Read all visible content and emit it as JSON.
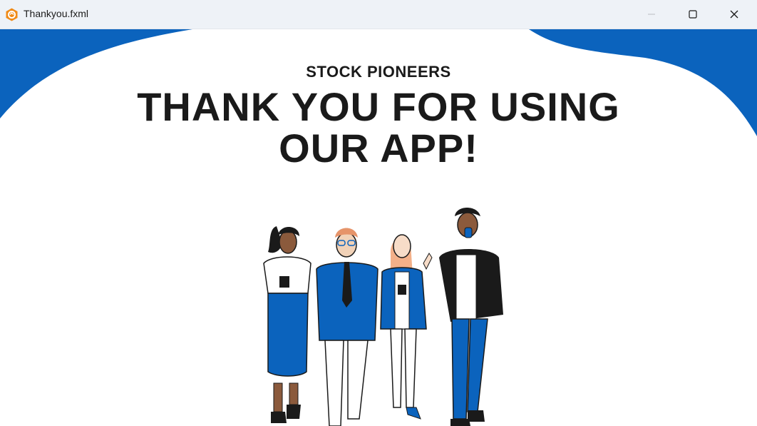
{
  "window": {
    "title": "Thankyou.fxml",
    "controls": {
      "minimize_icon": "minimize-icon",
      "maximize_icon": "maximize-icon",
      "close_icon": "close-icon"
    }
  },
  "main": {
    "brand": "STOCK PIONEERS",
    "headline_line1": "THANK YOU FOR USING",
    "headline_line2": "OUR APP!"
  },
  "colors": {
    "accent_blue": "#0b63bd",
    "text_dark": "#1a1a1a",
    "titlebar": "#eef2f7"
  },
  "illustration": {
    "icon": "team-of-four-people-illustration"
  }
}
